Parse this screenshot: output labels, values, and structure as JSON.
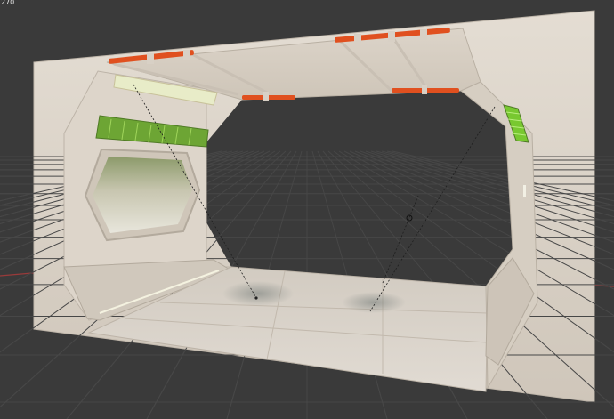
{
  "viewport": {
    "frame_counter": "270",
    "colors": {
      "background": "#3a3a3a",
      "grid_line": "#4a4a4a",
      "x_axis": "#9a3a3a",
      "wall": "#ddd5cb",
      "floor": "#d8d1c8",
      "pipe_accent": "#e0501f",
      "vent_green": "#78c830"
    }
  }
}
